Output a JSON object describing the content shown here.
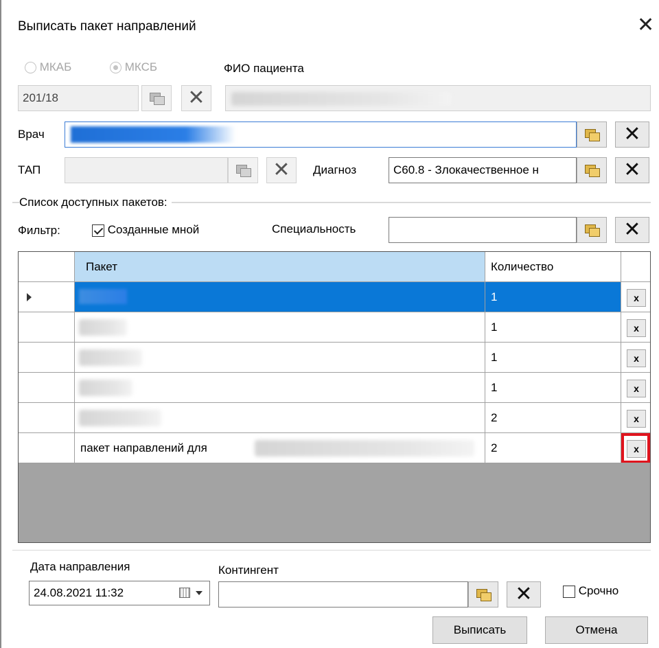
{
  "dialog": {
    "title": "Выписать пакет направлений"
  },
  "patient": {
    "radio_mkab": "МКАБ",
    "radio_mksb": "МКСБ",
    "fio_label": "ФИО пациента",
    "card_number": "201/18"
  },
  "doctor": {
    "label": "Врач"
  },
  "tap": {
    "label": "ТАП"
  },
  "diagnosis": {
    "label": "Диагноз",
    "value": "C60.8 - Злокачественное н"
  },
  "packages": {
    "section_label": "Список доступных пакетов:",
    "filter_label": "Фильтр:",
    "created_by_me_label": "Созданные мной",
    "specialty_label": "Специальность",
    "columns": {
      "package": "Пакет",
      "quantity": "Количество"
    },
    "rows": [
      {
        "name": "",
        "quantity": "1"
      },
      {
        "name": "",
        "quantity": "1"
      },
      {
        "name": "",
        "quantity": "1"
      },
      {
        "name": "",
        "quantity": "1"
      },
      {
        "name": "",
        "quantity": "2"
      },
      {
        "name": "пакет направлений для",
        "quantity": "2"
      }
    ],
    "delete_label": "x"
  },
  "footer": {
    "date_label": "Дата направления",
    "date_value": "24.08.2021 11:32",
    "contingent_label": "Контингент",
    "urgent_label": "Срочно",
    "submit_label": "Выписать",
    "cancel_label": "Отмена"
  },
  "colors": {
    "selection": "#0a78d7",
    "header_active": "#bcdcf4",
    "highlight": "#e0141e"
  }
}
